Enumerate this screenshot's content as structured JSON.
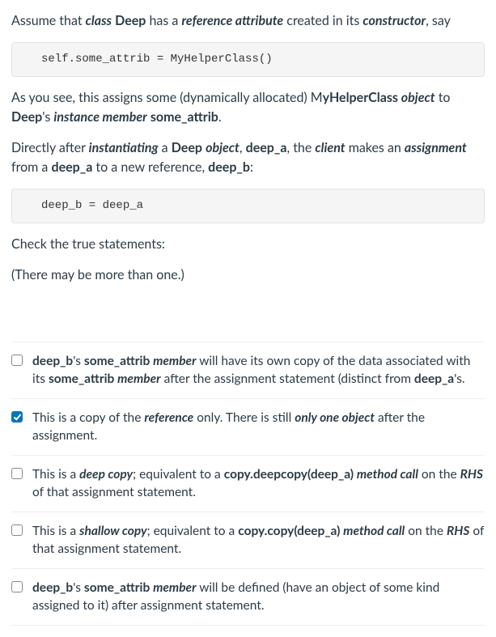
{
  "intro": {
    "p1_pre": "Assume that ",
    "p1_bi_class": "class",
    "p1_sp1": " ",
    "p1_b_deep": "Deep",
    "p1_mid1": " has a ",
    "p1_bi_refattr": "reference attribute",
    "p1_mid2": " created in its ",
    "p1_bi_ctor": "constructor",
    "p1_post": ", say"
  },
  "code1": "self.some_attrib = MyHelperClass()",
  "para2": {
    "pre": "As you see, this assigns some (dynamically allocated) M",
    "b1": "yHelperClass ",
    "bi_obj": "object",
    "mid1": " to ",
    "b_deep": "Deep",
    "mid2": "'s ",
    "bi_inst": "instance member",
    "sp": " ",
    "b_attr": "some_attrib",
    "post": "."
  },
  "para3": {
    "pre": "Directly after ",
    "bi_inst": "instantiating",
    "mid1": " a ",
    "b_deep": "Deep",
    "sp1": " ",
    "bi_obj": "object",
    "mid2": ", ",
    "b_deepa": "deep_a",
    "mid3": ", the ",
    "bi_client": "client",
    "mid4": " makes an ",
    "bi_assign": "assignment",
    "mid5": " from a ",
    "b_deepa2": "deep_a",
    "mid6": " to a  new reference, ",
    "b_deepb": "deep_b",
    "post": ":"
  },
  "code2": "deep_b = deep_a",
  "prompt1": "Check the true statements:",
  "prompt2": "(There may be more than one.)",
  "options": [
    {
      "checked": false,
      "parts": {
        "b1": "deep_b",
        "t1": "'s ",
        "b2": "some_attrib ",
        "bi1": "member",
        "t2": " will have its own copy of the data associated with its ",
        "b3": "some_attrib ",
        "bi2": "member",
        "t3": " after the assignment statement (distinct from ",
        "b4": "deep_a",
        "t4": "'s."
      }
    },
    {
      "checked": true,
      "parts": {
        "t1": "This is a copy of the ",
        "bi1": "reference",
        "t2": " only.  There is still ",
        "bi2": "only one object",
        "t3": " after the assignment."
      }
    },
    {
      "checked": false,
      "parts": {
        "t1": "This is a ",
        "bi1": "deep copy",
        "t2": ";  equivalent to a ",
        "b1": "copy.deepcopy(deep_a) ",
        "bi2": "method call",
        "t3": " on the ",
        "bi3": "RHS",
        "t4": " of that assignment statement."
      }
    },
    {
      "checked": false,
      "parts": {
        "t1": "This is a ",
        "bi1": "shallow copy",
        "t2": ";  equivalent to a ",
        "b1": "copy.copy(deep_a) ",
        "bi2": "method call",
        "t3": " on the ",
        "bi3": "RHS",
        "t4": " of that assignment statement."
      }
    },
    {
      "checked": false,
      "parts": {
        "b1": "deep_b",
        "t1": "'s ",
        "b2": "some_attrib ",
        "bi1": "member",
        "t2": " will be defined (have an object of some kind assigned to it) after assignment statement."
      }
    }
  ]
}
